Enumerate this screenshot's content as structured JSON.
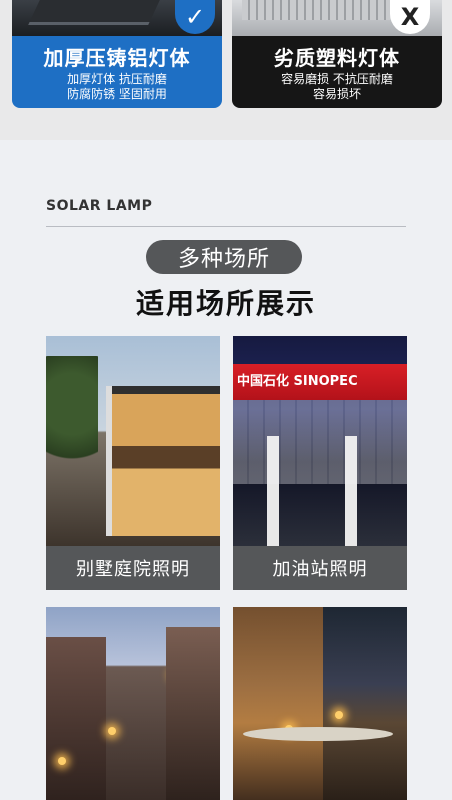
{
  "comparison": {
    "good": {
      "badge_icon": "check-icon",
      "badge_glyph": "✓",
      "title": "加厚压铸铝灯体",
      "line1": "加厚灯体 抗压耐磨",
      "line2": "防腐防锈 坚固耐用",
      "color": "#1e6fc4"
    },
    "bad": {
      "badge_icon": "x-icon",
      "badge_glyph": "X",
      "title": "劣质塑料灯体",
      "line1": "容易磨损 不抗压耐磨",
      "line2": "容易损坏",
      "color": "#161616"
    }
  },
  "scenes": {
    "section_label": "SOLAR LAMP",
    "pill": "多种场所",
    "heading": "适用场所展示",
    "tiles": [
      {
        "caption": "别墅庭院照明"
      },
      {
        "caption": "加油站照明",
        "sign_text": "中国石化 SINOPEC"
      },
      {
        "caption": ""
      },
      {
        "caption": ""
      }
    ]
  }
}
